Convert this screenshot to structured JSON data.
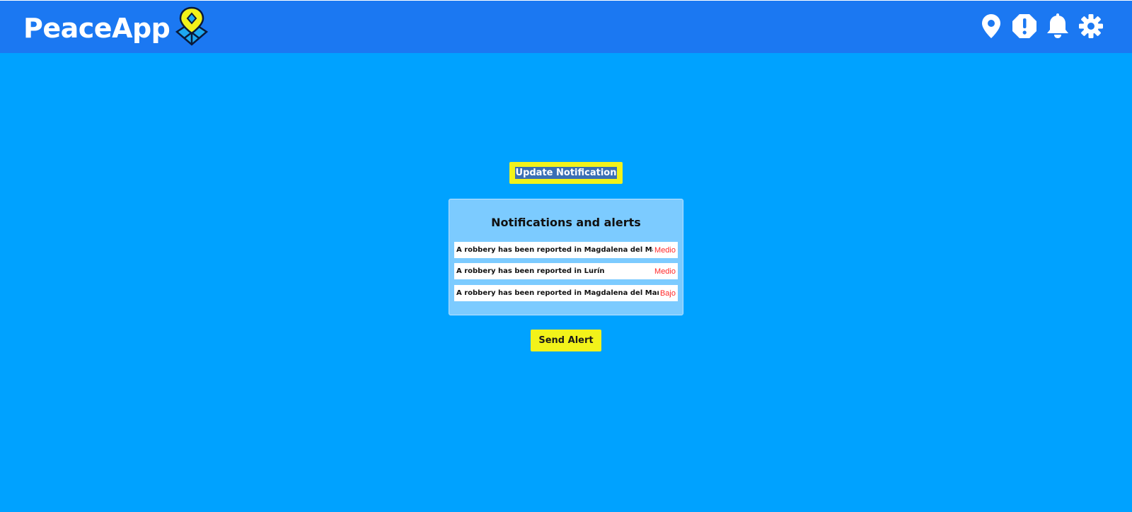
{
  "app": {
    "name": "PeaceApp"
  },
  "header": {
    "icons": [
      {
        "name": "location-pin-icon"
      },
      {
        "name": "alert-octagon-icon"
      },
      {
        "name": "bell-icon"
      },
      {
        "name": "gear-icon"
      }
    ]
  },
  "actions": {
    "update_label": "Update Notification",
    "send_label": "Send Alert"
  },
  "panel": {
    "title": "Notifications and alerts",
    "notifications": [
      {
        "text": "A robbery has been reported in Magdalena del Mar",
        "level": "Medio"
      },
      {
        "text": "A robbery has been reported in Lurín",
        "level": "Medio"
      },
      {
        "text": "A robbery has been reported in Magdalena del Mar",
        "level": "Bajo"
      }
    ]
  },
  "colors": {
    "background": "#00a2ff",
    "topbar": "#1b78f2",
    "button": "#f2f21a",
    "panel": "#7ccbff",
    "level_text": "#ff2a2a",
    "logo_pin": "#f2f21a"
  }
}
